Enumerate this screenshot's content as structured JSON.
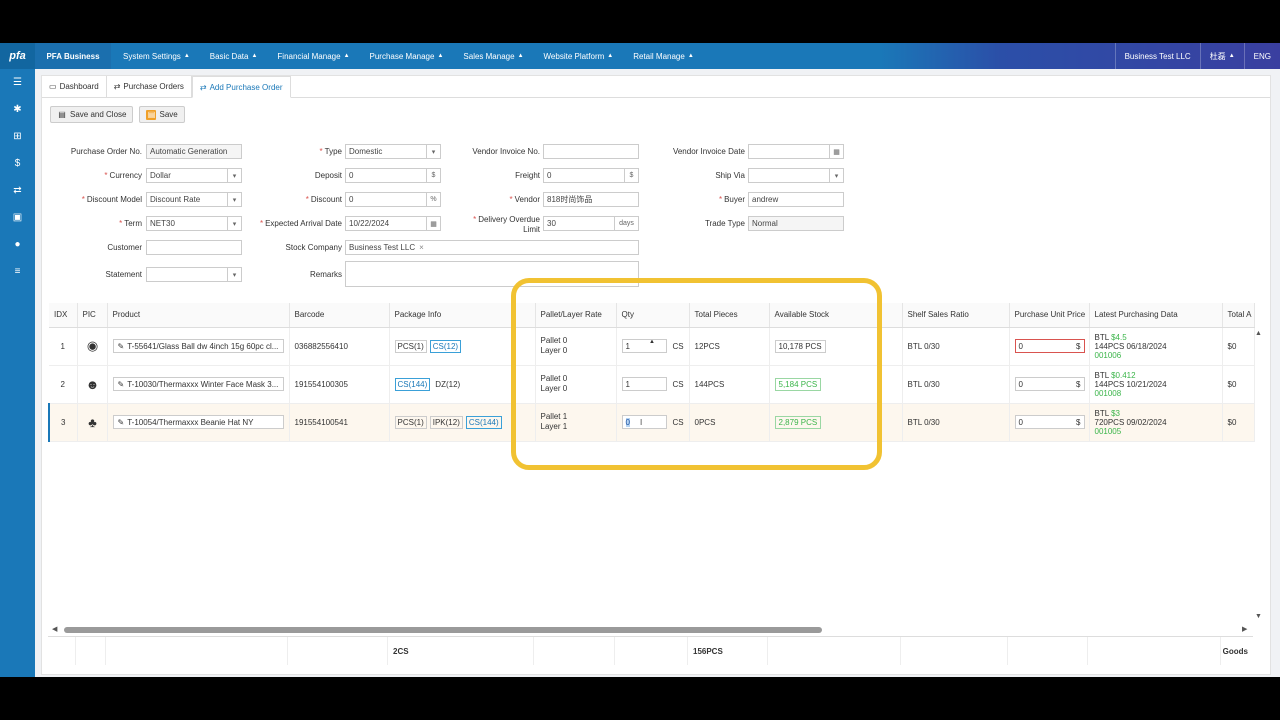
{
  "app": {
    "logo": "pfa",
    "brand": "PFA Business"
  },
  "topmenu": [
    {
      "label": "System Settings"
    },
    {
      "label": "Basic Data"
    },
    {
      "label": "Financial Manage"
    },
    {
      "label": "Purchase Manage"
    },
    {
      "label": "Sales Manage"
    },
    {
      "label": "Website Platform"
    },
    {
      "label": "Retail Manage"
    }
  ],
  "topright": {
    "company": "Business Test LLC",
    "user": "杜磊",
    "lang": "ENG"
  },
  "sidebar_icons": [
    "list-icon",
    "gear-icon",
    "sitemap-icon",
    "dollar-icon",
    "refresh-icon",
    "money-icon",
    "globe-icon",
    "menu-icon"
  ],
  "tabs": [
    {
      "label": "Dashboard",
      "icon": "monitor-icon"
    },
    {
      "label": "Purchase Orders",
      "icon": "refresh-icon"
    },
    {
      "label": "Add Purchase Order",
      "icon": "refresh-icon"
    }
  ],
  "toolbar": {
    "save_close": "Save and Close",
    "save": "Save"
  },
  "form": {
    "po_no_label": "Purchase Order No.",
    "po_no_value": "Automatic Generation",
    "type_label": "Type",
    "type_value": "Domestic",
    "vendor_invoice_no_label": "Vendor Invoice No.",
    "vendor_invoice_no_value": "",
    "vendor_invoice_date_label": "Vendor Invoice Date",
    "vendor_invoice_date_value": "",
    "currency_label": "Currency",
    "currency_value": "Dollar",
    "deposit_label": "Deposit",
    "deposit_value": "0",
    "freight_label": "Freight",
    "freight_value": "0",
    "ship_via_label": "Ship Via",
    "ship_via_value": "",
    "discount_model_label": "Discount Model",
    "discount_model_value": "Discount Rate",
    "discount_label": "Discount",
    "discount_value": "0",
    "vendor_label": "Vendor",
    "vendor_value": "818时尚饰品",
    "buyer_label": "Buyer",
    "buyer_value": "andrew",
    "term_label": "Term",
    "term_value": "NET30",
    "arrival_label": "Expected Arrival Date",
    "arrival_value": "10/22/2024",
    "overdue_label": "Delivery Overdue Limit",
    "overdue_value": "30",
    "overdue_unit": "days",
    "trade_type_label": "Trade Type",
    "trade_type_value": "Normal",
    "customer_label": "Customer",
    "customer_value": "",
    "stock_company_label": "Stock Company",
    "stock_company_value": "Business Test LLC",
    "statement_label": "Statement",
    "statement_value": "",
    "remarks_label": "Remarks",
    "remarks_value": "",
    "dollar_sym": "$",
    "percent_sym": "%"
  },
  "table": {
    "headers": [
      "IDX",
      "PIC",
      "Product",
      "Barcode",
      "Package Info",
      "Pallet/Layer Rate",
      "Qty",
      "Total Pieces",
      "Available Stock",
      "",
      "Shelf Sales Ratio",
      "Purchase Unit Price",
      "Latest Purchasing Data",
      "Total A"
    ],
    "rows": [
      {
        "idx": "1",
        "product": "T-55641/Glass Ball dw 4inch 15g 60pc cl...",
        "barcode": "036882556410",
        "packages": [
          {
            "label": "PCS(1)",
            "blue": false
          },
          {
            "label": "CS(12)",
            "blue": true
          }
        ],
        "pallet": "Pallet 0",
        "layer": "Layer 0",
        "qty": "1",
        "unit": "CS",
        "total_pieces": "12PCS",
        "stock": "10,178 PCS",
        "stock_green": false,
        "shelf": "BTL 0/30",
        "price": "0",
        "price_err": true,
        "lpd_prefix": "BTL",
        "lpd_price": "$4.5",
        "lpd_line2": "144PCS 06/18/2024",
        "lpd_code": "001006",
        "total": "$0"
      },
      {
        "idx": "2",
        "product": "T-10030/Thermaxxx Winter Face Mask 3...",
        "barcode": "191554100305",
        "packages": [
          {
            "label": "CS(144)",
            "blue": true
          },
          {
            "label": "DZ(12)",
            "blue": false
          }
        ],
        "pallet": "Pallet 0",
        "layer": "Layer 0",
        "qty": "1",
        "unit": "CS",
        "total_pieces": "144PCS",
        "stock": "5,184 PCS",
        "stock_green": true,
        "shelf": "BTL 0/30",
        "price": "0",
        "price_err": false,
        "lpd_prefix": "BTL",
        "lpd_price": "$0.412",
        "lpd_line2": "144PCS 10/21/2024",
        "lpd_code": "001008",
        "total": "$0"
      },
      {
        "idx": "3",
        "product": "T-10054/Thermaxxx Beanie Hat NY",
        "barcode": "191554100541",
        "packages": [
          {
            "label": "PCS(1)",
            "blue": false
          },
          {
            "label": "IPK(12)",
            "blue": false
          },
          {
            "label": "CS(144)",
            "blue": true
          }
        ],
        "pallet": "Pallet 1",
        "layer": "Layer 1",
        "qty": "0",
        "unit": "CS",
        "total_pieces": "0PCS",
        "stock": "2,879 PCS",
        "stock_green": true,
        "shelf": "BTL 0/30",
        "price": "0",
        "price_err": false,
        "lpd_prefix": "BTL",
        "lpd_price": "$3",
        "lpd_line2": "720PCS 09/02/2024",
        "lpd_code": "001005",
        "total": "$0"
      }
    ]
  },
  "footer": {
    "package_total": "2CS",
    "pieces_total": "156PCS",
    "goods": "Goods"
  },
  "colors": {
    "brand": "#1a78b8",
    "highlight": "#f1c232",
    "green": "#3bb54a",
    "error": "#d9534f"
  }
}
